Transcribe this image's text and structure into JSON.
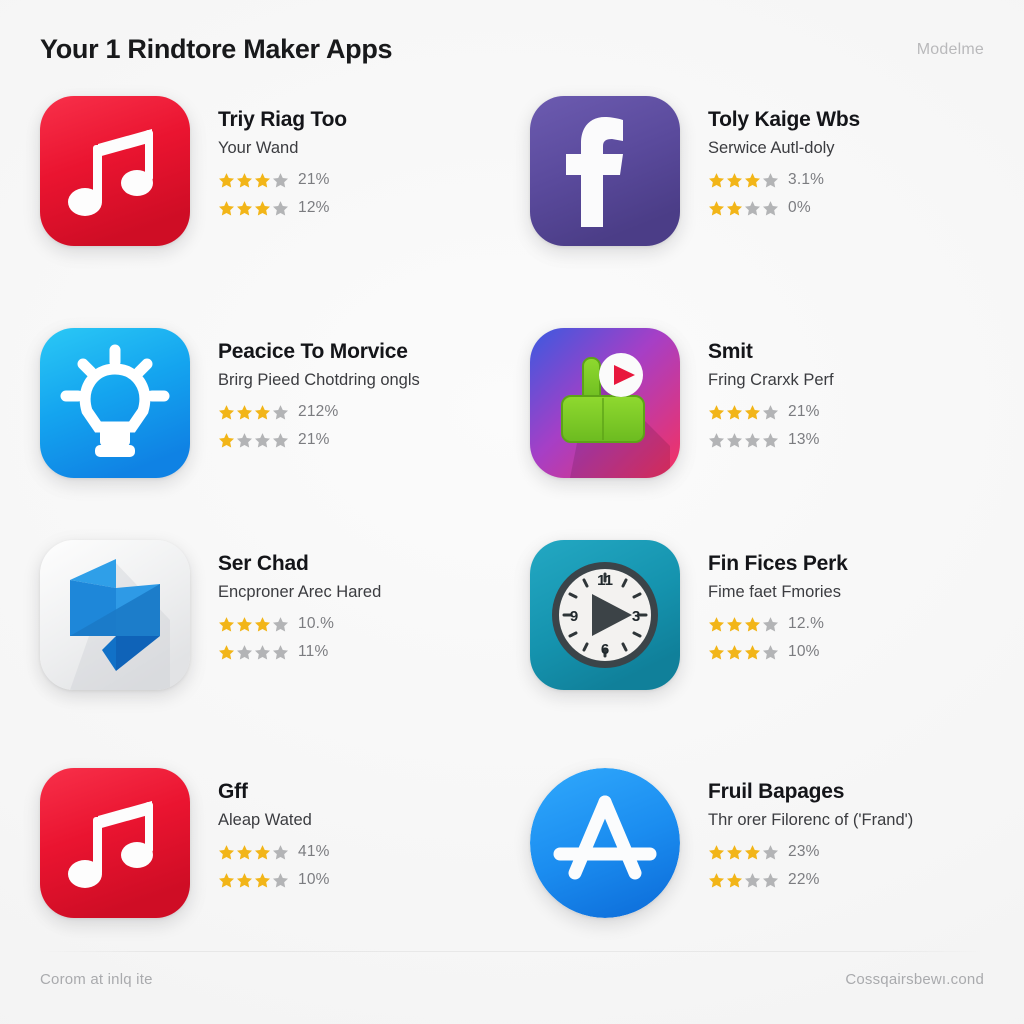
{
  "header": {
    "title": "Your 1 Rindtore Maker Apps",
    "brand": "Modelme"
  },
  "footer": {
    "left": "Corom at inlq ite",
    "right": "Cossqairsbewı.cond"
  },
  "colors": {
    "page_background": "#f7f7f7",
    "star_filled": "#f2b518",
    "star_empty": "#b3b4b6",
    "title_text": "#141519",
    "muted_text": "#a9aaad"
  },
  "apps": [
    {
      "icon": "music-note-icon",
      "icon_style": "rounded-square",
      "icon_color": "#e8152b",
      "name": "Triy Riag Too",
      "subtitle": "Your Wand",
      "ratings": [
        {
          "filled": 3,
          "total": 4,
          "percent": "21%"
        },
        {
          "filled": 3,
          "total": 4,
          "percent": "12%"
        }
      ]
    },
    {
      "icon": "facebook-f-icon",
      "icon_style": "rounded-square",
      "icon_color": "#5b4a9e",
      "name": "Toly Kaige Wbs",
      "subtitle": "Serwice Autl-doly",
      "ratings": [
        {
          "filled": 3,
          "total": 4,
          "percent": "3.1%"
        },
        {
          "filled": 2,
          "total": 4,
          "percent": "0%"
        }
      ]
    },
    {
      "icon": "lightbulb-idea-icon",
      "icon_style": "rounded-square",
      "icon_color": "#19a6f0",
      "name": "Peacice To Morvice",
      "subtitle": "Brirg Pieed Chotdring ongls",
      "ratings": [
        {
          "filled": 3,
          "total": 4,
          "percent": "212%"
        },
        {
          "filled": 1,
          "total": 4,
          "percent": "21%"
        }
      ]
    },
    {
      "icon": "thumbs-up-play-icon",
      "icon_style": "rounded-square",
      "icon_color": "#c23ca4",
      "name": "Smit",
      "subtitle": "Fring Crarxk Perf",
      "ratings": [
        {
          "filled": 3,
          "total": 4,
          "percent": "21%"
        },
        {
          "filled": 0,
          "total": 4,
          "percent": "13%"
        }
      ]
    },
    {
      "icon": "folded-paper-icon",
      "icon_style": "rounded-square",
      "icon_color": "#eceded",
      "name": "Ser Chad",
      "subtitle": "Encproner Arec Hared",
      "ratings": [
        {
          "filled": 3,
          "total": 4,
          "percent": "10.%"
        },
        {
          "filled": 1,
          "total": 4,
          "percent": "11%"
        }
      ]
    },
    {
      "icon": "clock-play-icon",
      "icon_style": "rounded-square",
      "icon_color": "#1a94ae",
      "name": "Fin Fices Perk",
      "subtitle": "Fime faet Fmories",
      "ratings": [
        {
          "filled": 3,
          "total": 4,
          "percent": "12.%"
        },
        {
          "filled": 3,
          "total": 4,
          "percent": "10%"
        }
      ]
    },
    {
      "icon": "music-note-icon",
      "icon_style": "rounded-square",
      "icon_color": "#e8152b",
      "name": "Gff",
      "subtitle": "Aleap Wated",
      "ratings": [
        {
          "filled": 3,
          "total": 4,
          "percent": "41%"
        },
        {
          "filled": 3,
          "total": 4,
          "percent": "10%"
        }
      ]
    },
    {
      "icon": "app-store-icon",
      "icon_style": "circle",
      "icon_color": "#1f8ef1",
      "name": "Fruil Bapages",
      "subtitle": "Thr orer Filorenc of ('Frand')",
      "ratings": [
        {
          "filled": 3,
          "total": 4,
          "percent": "23%"
        },
        {
          "filled": 2,
          "total": 4,
          "percent": "22%"
        }
      ]
    }
  ]
}
